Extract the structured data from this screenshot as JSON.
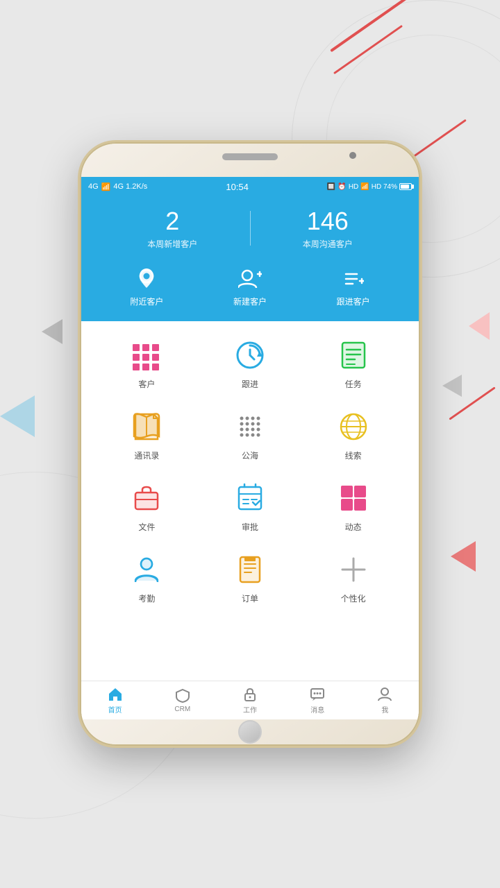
{
  "status_bar": {
    "left": "4G  1.2K/s",
    "center": "10:54",
    "right": "HD  74%"
  },
  "header": {
    "stat1_number": "2",
    "stat1_label": "本周新增客户",
    "stat2_number": "146",
    "stat2_label": "本周沟通客户"
  },
  "quick_actions": [
    {
      "label": "附近客户",
      "icon": "location"
    },
    {
      "label": "新建客户",
      "icon": "add-person"
    },
    {
      "label": "跟进客户",
      "icon": "add-list"
    }
  ],
  "grid_rows": [
    [
      {
        "label": "客户",
        "icon": "grid",
        "color": "#e84b8a"
      },
      {
        "label": "跟进",
        "icon": "refresh-clock",
        "color": "#29abe2"
      },
      {
        "label": "任务",
        "icon": "task-list",
        "color": "#26c44b"
      }
    ],
    [
      {
        "label": "通讯录",
        "icon": "book",
        "color": "#e8a020"
      },
      {
        "label": "公海",
        "icon": "dots-grid",
        "color": "#888"
      },
      {
        "label": "线索",
        "icon": "globe",
        "color": "#e8c020"
      }
    ],
    [
      {
        "label": "文件",
        "icon": "briefcase",
        "color": "#e84b4b"
      },
      {
        "label": "审批",
        "icon": "calendar-check",
        "color": "#29abe2"
      },
      {
        "label": "动态",
        "icon": "four-squares",
        "color": "#e84b8a"
      }
    ],
    [
      {
        "label": "考勤",
        "icon": "person-card",
        "color": "#29abe2"
      },
      {
        "label": "订单",
        "icon": "order-list",
        "color": "#e8a020"
      },
      {
        "label": "个性化",
        "icon": "plus-circle",
        "color": "#aaa"
      }
    ]
  ],
  "bottom_nav": [
    {
      "label": "首页",
      "icon": "home",
      "active": true
    },
    {
      "label": "CRM",
      "icon": "shield",
      "active": false
    },
    {
      "label": "工作",
      "icon": "lock",
      "active": false
    },
    {
      "label": "消息",
      "icon": "chat",
      "active": false
    },
    {
      "label": "我",
      "icon": "person",
      "active": false
    }
  ]
}
